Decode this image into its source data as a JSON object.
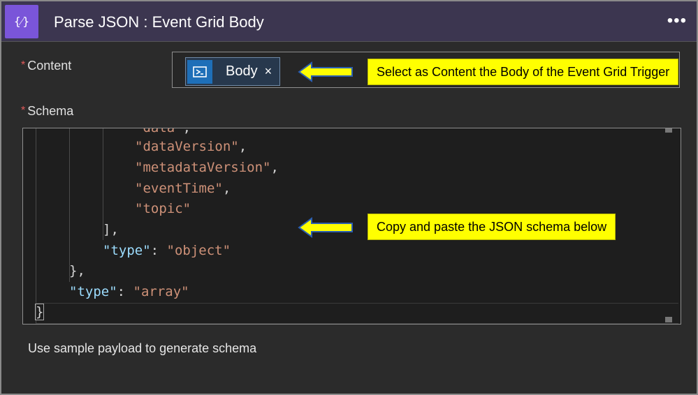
{
  "header": {
    "icon": "curly-braces-icon",
    "icon_glyph": "{⁄}",
    "title": "Parse JSON : Event Grid Body",
    "menu": "•••"
  },
  "content": {
    "required_mark": "*",
    "label": "Content",
    "token_label": "Body",
    "token_close": "×",
    "token_icon": "event-grid-icon"
  },
  "schema": {
    "required_mark": "*",
    "label": "Schema",
    "lines": [
      {
        "indent": "            ",
        "str": "\"data\"",
        "tail": ","
      },
      {
        "indent": "            ",
        "str": "\"dataVersion\"",
        "tail": ","
      },
      {
        "indent": "            ",
        "str": "\"metadataVersion\"",
        "tail": ","
      },
      {
        "indent": "            ",
        "str": "\"eventTime\"",
        "tail": ","
      },
      {
        "indent": "            ",
        "str": "\"topic\"",
        "tail": ""
      }
    ],
    "close_array": "],",
    "type_key_inner": "\"type\"",
    "type_val_inner": "\"object\"",
    "close_obj": "},",
    "type_key_outer": "\"type\"",
    "type_val_outer": "\"array\"",
    "close_root": "}",
    "colon": ": "
  },
  "callouts": {
    "content_hint": "Select as Content the Body of the Event Grid Trigger",
    "schema_hint": "Copy and paste the JSON schema below",
    "color": "#ffff00"
  },
  "footer": {
    "sample_payload": "Use sample payload to generate schema"
  }
}
